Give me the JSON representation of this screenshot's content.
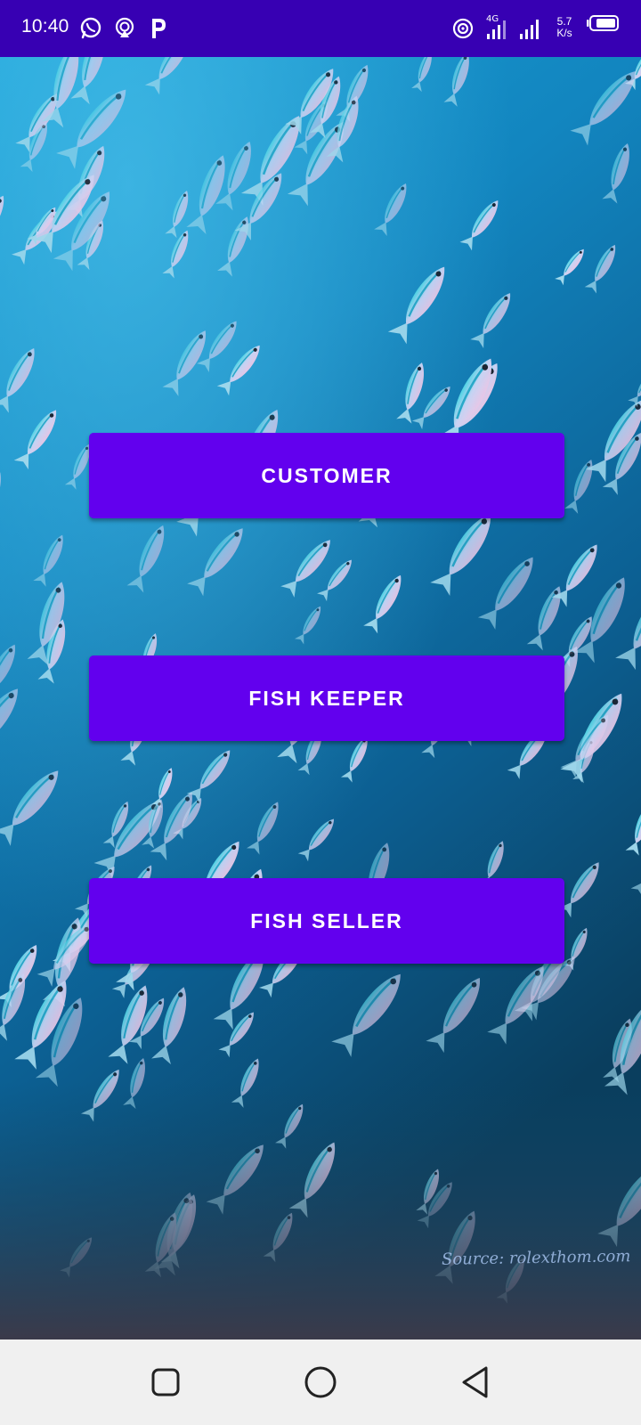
{
  "status_bar": {
    "time": "10:40",
    "network_speed_value": "5.7",
    "network_speed_unit": "K/s",
    "network_type": "4G",
    "left_icons": [
      "whatsapp-icon",
      "airdrop-icon",
      "paytm-icon"
    ],
    "right_icons": [
      "hotspot-icon",
      "signal-4g-icon",
      "signal-icon",
      "battery-icon"
    ],
    "background_color": "#3700b3"
  },
  "background": {
    "description_icon": "fish-school-image",
    "watermark": "Source: rolexthom.com"
  },
  "buttons": {
    "customer": "CUSTOMER",
    "fish_keeper": "FISH KEEPER",
    "fish_seller": "FISH SELLER",
    "color": "#6200ee"
  },
  "nav_bar": {
    "items": [
      "recents-icon",
      "home-icon",
      "back-icon"
    ]
  }
}
